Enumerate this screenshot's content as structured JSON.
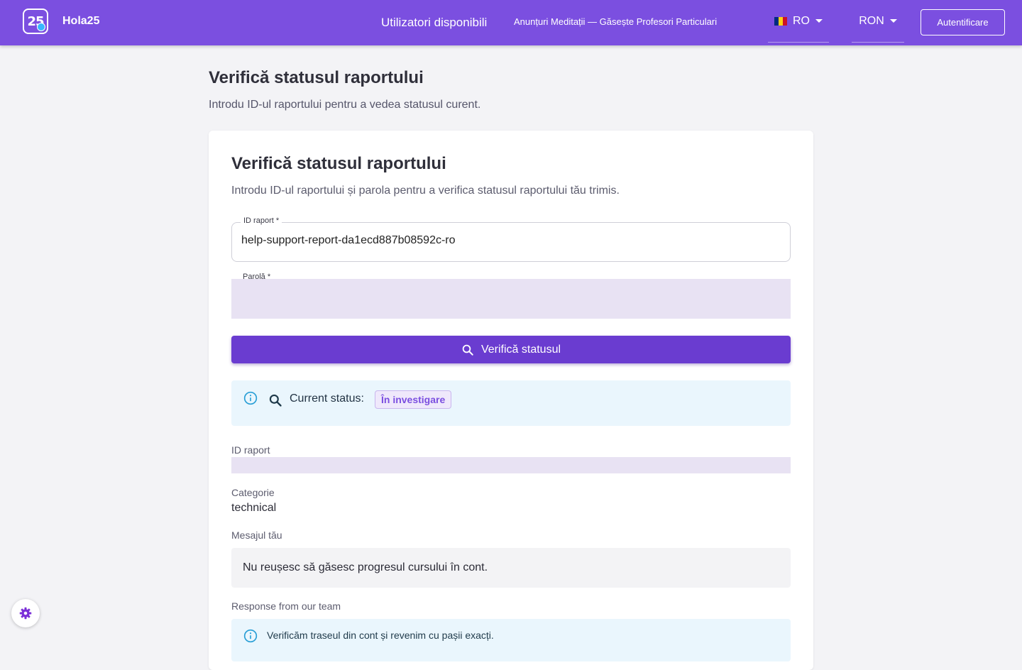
{
  "header": {
    "logo_text": "25",
    "brand": "Hola25",
    "nav_users": "Utilizatori disponibili",
    "nav_ads": "Anunțuri Meditații — Găsește Profesori Particulari",
    "language": "RO",
    "currency": "RON",
    "login_label": "Autentificare",
    "flag_colors": [
      "#002b7f",
      "#fcd116",
      "#ce1126"
    ]
  },
  "page": {
    "title": "Verifică statusul raportului",
    "subtitle": "Introdu ID-ul raportului pentru a vedea statusul curent."
  },
  "card": {
    "title": "Verifică statusul raportului",
    "subtitle": "Introdu ID-ul raportului și parola pentru a verifica statusul raportului tău trimis.",
    "id_field": {
      "label": "ID raport *",
      "value": "help-support-report-da1ecd887b08592c-ro"
    },
    "password_field": {
      "label": "Parolă *",
      "value": ""
    },
    "check_button": "Verifică statusul",
    "status": {
      "label": "Current status:",
      "value": "În investigare"
    },
    "details": {
      "id_label": "ID raport",
      "category_label": "Categorie",
      "category_value": "technical",
      "message_label": "Mesajul tău",
      "message_value": "Nu reușesc să găsesc progresul cursului în cont.",
      "response_label": "Response from our team",
      "response_value": "Verificăm traseul din cont și revenim cu pașii exacți."
    }
  },
  "colors": {
    "accent": "#7b4fe0",
    "button": "#6a3cd0",
    "info_bg": "#eaf6fd",
    "info_icon": "#2a9fd6"
  },
  "icons": {
    "settings": "gear-icon",
    "search": "search-icon",
    "info": "info-icon"
  }
}
